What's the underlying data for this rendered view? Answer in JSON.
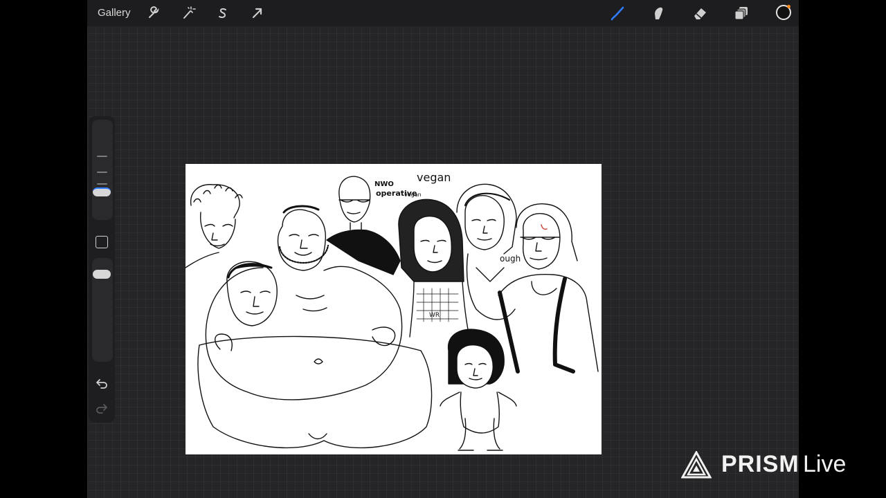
{
  "topbar": {
    "gallery_label": "Gallery",
    "left_tools": [
      {
        "name": "actions",
        "icon": "wrench-icon"
      },
      {
        "name": "adjustments",
        "icon": "magic-wand-icon"
      },
      {
        "name": "selection",
        "icon": "selection-s-icon"
      },
      {
        "name": "transform",
        "icon": "arrow-cursor-icon"
      }
    ],
    "right_tools": [
      {
        "name": "brush",
        "icon": "brush-icon",
        "active": true
      },
      {
        "name": "smudge",
        "icon": "smudge-finger-icon"
      },
      {
        "name": "eraser",
        "icon": "eraser-icon"
      },
      {
        "name": "layers",
        "icon": "layers-icon"
      }
    ],
    "current_color": "#111111",
    "accent_color": "#2f7cff"
  },
  "sidebar": {
    "brush_size_slider": {
      "icon": "size-slider-icon"
    },
    "modify_button": {
      "icon": "square-modify-icon"
    },
    "opacity_slider": {
      "icon": "opacity-slider-icon"
    },
    "undo": {
      "icon": "undo-arrow-icon"
    },
    "redo": {
      "icon": "redo-arrow-icon"
    }
  },
  "canvas": {
    "labels": {
      "nwo": "NWO",
      "operative": "operative",
      "vegan_small": "vegan",
      "vegan_large": "vegan",
      "ough": "ough",
      "wr": "WR"
    }
  },
  "watermark": {
    "prism": "PRISM",
    "live": "Live",
    "icon": "prism-triangle-logo-icon"
  }
}
